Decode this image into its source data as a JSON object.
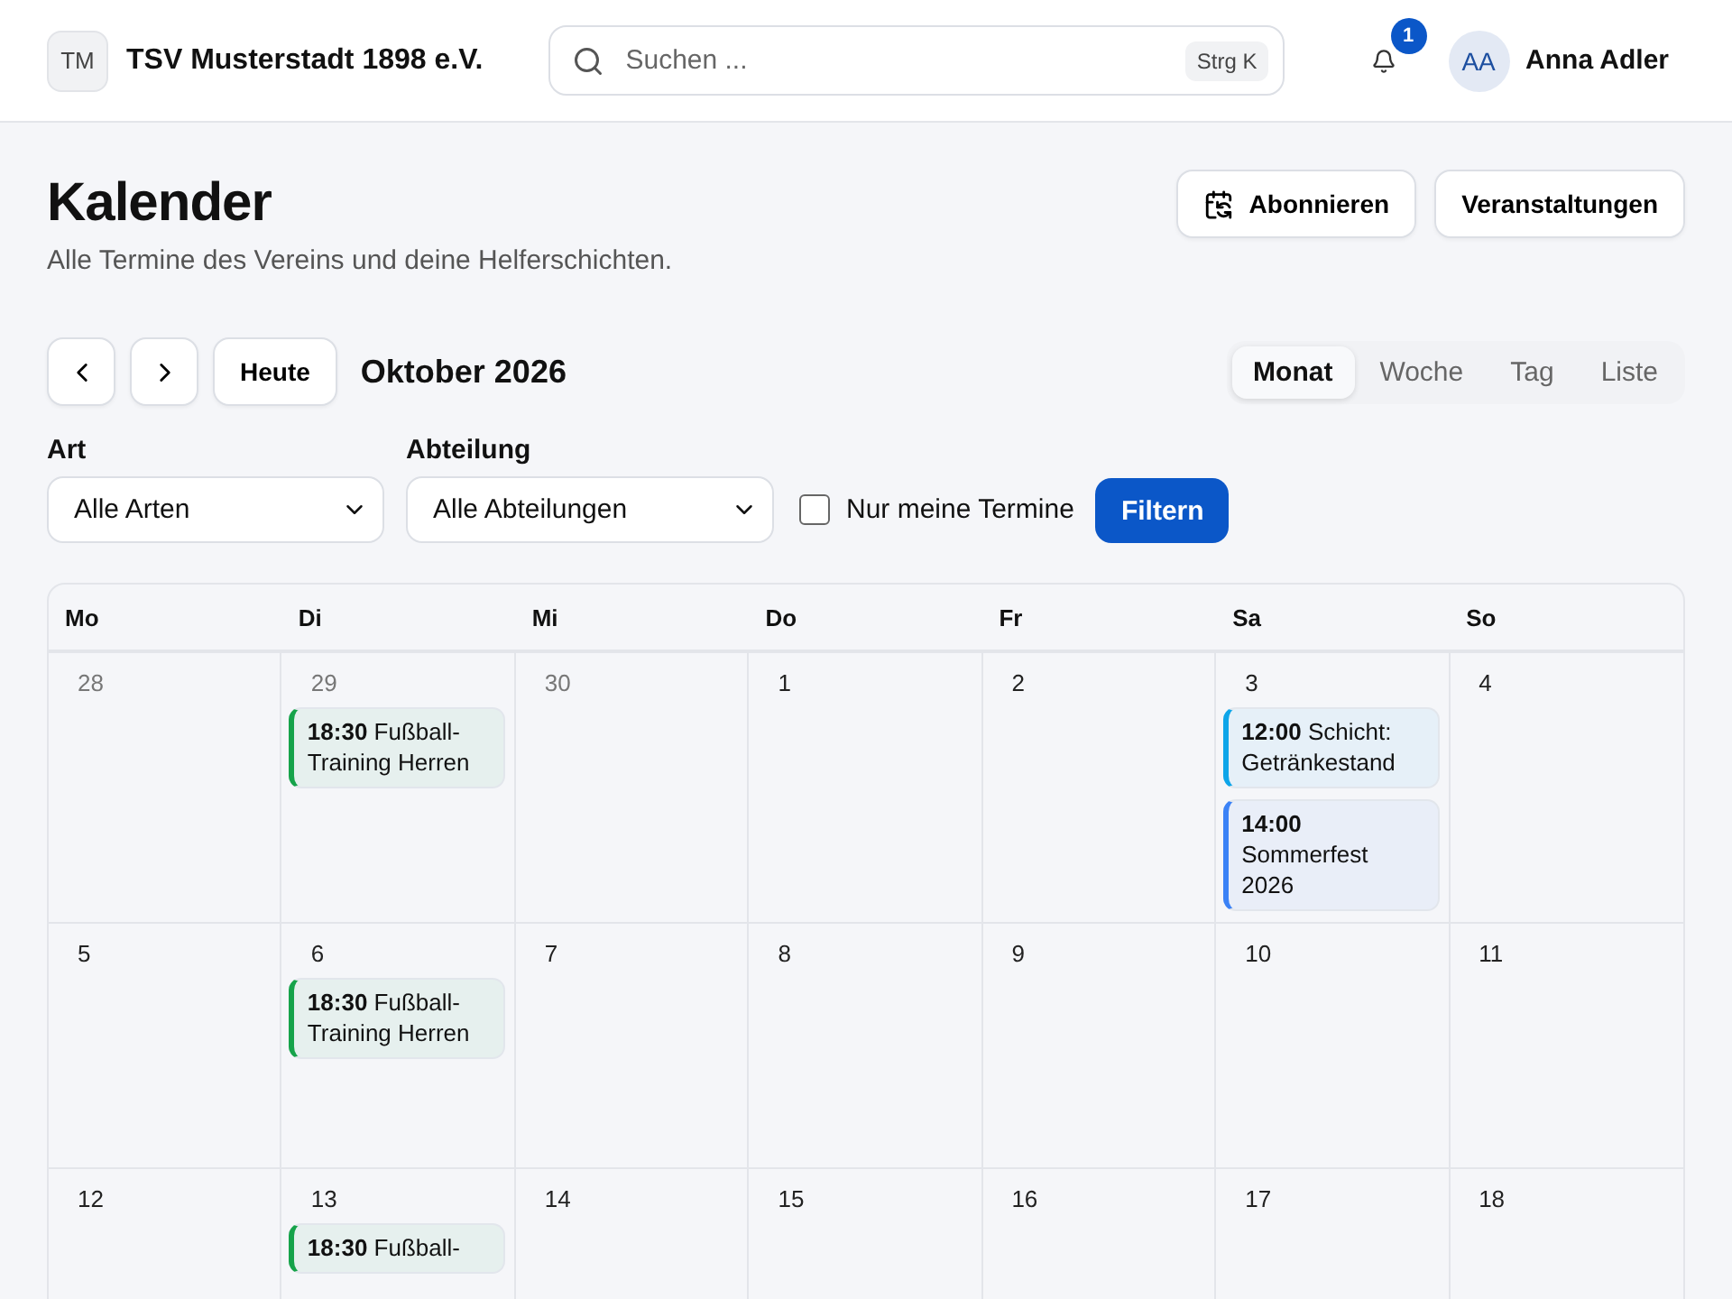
{
  "header": {
    "logo": "TM",
    "club": "TSV Musterstadt 1898 e.V.",
    "search": {
      "placeholder": "Suchen ...",
      "shortcut": "Strg K"
    },
    "notifications": "1",
    "user": {
      "initials": "AA",
      "name": "Anna Adler"
    }
  },
  "page": {
    "title": "Kalender",
    "subtitle": "Alle Termine des Vereins und deine Helferschichten.",
    "actions": [
      "Abonnieren",
      "Veranstaltungen"
    ]
  },
  "toolbar": {
    "today": "Heute",
    "month": "Oktober 2026",
    "views": [
      {
        "label": "Monat",
        "selected": true
      },
      {
        "label": "Woche",
        "selected": false
      },
      {
        "label": "Tag",
        "selected": false
      },
      {
        "label": "Liste",
        "selected": false
      }
    ]
  },
  "filters": {
    "type": {
      "label": "Art",
      "value": "Alle Arten"
    },
    "department": {
      "label": "Abteilung",
      "value": "Alle Abteilungen"
    },
    "only_mine": {
      "label": "Nur meine Termine",
      "checked": false
    },
    "submit": "Filtern"
  },
  "calendar": {
    "weekdays": [
      "Mo",
      "Di",
      "Mi",
      "Do",
      "Fr",
      "Sa",
      "So"
    ],
    "weeks": [
      {
        "days": [
          {
            "day": "28",
            "in_month": false
          },
          {
            "day": "29",
            "in_month": false,
            "events": [
              {
                "time": "18:30",
                "title": "Fußball-Training Herren",
                "color": "#16a34a"
              }
            ]
          },
          {
            "day": "30",
            "in_month": false
          },
          {
            "day": "1",
            "in_month": true
          },
          {
            "day": "2",
            "in_month": true
          },
          {
            "day": "3",
            "in_month": true,
            "events": [
              {
                "time": "12:00",
                "title": "Schicht: Getränkestand",
                "color": "#0ea5e9"
              },
              {
                "time": "14:00",
                "title": "Sommerfest 2026",
                "color": "#3b82f6"
              }
            ]
          },
          {
            "day": "4",
            "in_month": true
          }
        ]
      },
      {
        "days": [
          {
            "day": "5",
            "in_month": true
          },
          {
            "day": "6",
            "in_month": true,
            "events": [
              {
                "time": "18:30",
                "title": "Fußball-Training Herren",
                "color": "#16a34a"
              }
            ]
          },
          {
            "day": "7",
            "in_month": true
          },
          {
            "day": "8",
            "in_month": true
          },
          {
            "day": "9",
            "in_month": true
          },
          {
            "day": "10",
            "in_month": true
          },
          {
            "day": "11",
            "in_month": true
          }
        ]
      },
      {
        "days": [
          {
            "day": "12",
            "in_month": true
          },
          {
            "day": "13",
            "in_month": true,
            "events": [
              {
                "time": "18:30",
                "title": "Fußball-",
                "color": "#16a34a"
              }
            ]
          },
          {
            "day": "14",
            "in_month": true
          },
          {
            "day": "15",
            "in_month": true
          },
          {
            "day": "16",
            "in_month": true
          },
          {
            "day": "17",
            "in_month": true
          },
          {
            "day": "18",
            "in_month": true
          }
        ]
      }
    ]
  }
}
